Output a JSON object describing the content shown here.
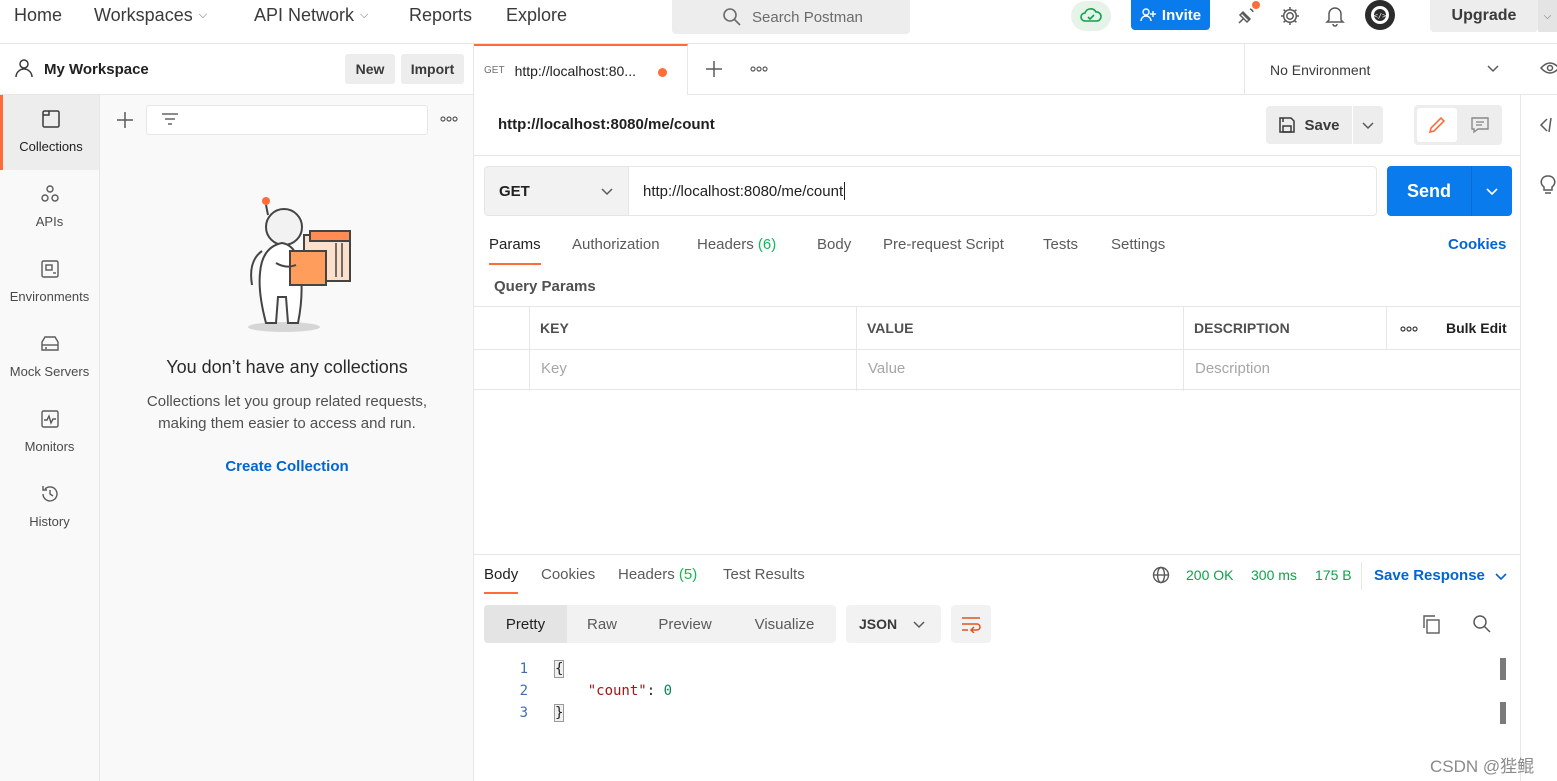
{
  "topnav": {
    "items": [
      {
        "label": "Home",
        "has_chevron": false
      },
      {
        "label": "Workspaces",
        "has_chevron": true
      },
      {
        "label": "API Network",
        "has_chevron": true
      },
      {
        "label": "Reports",
        "has_chevron": false
      },
      {
        "label": "Explore",
        "has_chevron": false
      }
    ],
    "search_placeholder": "Search Postman",
    "invite_label": "Invite",
    "upgrade_label": "Upgrade"
  },
  "workspace": {
    "title": "My Workspace",
    "new_label": "New",
    "import_label": "Import"
  },
  "rail": {
    "items": [
      {
        "label": "Collections",
        "icon": "collections-icon",
        "active": true
      },
      {
        "label": "APIs",
        "icon": "apis-icon",
        "active": false
      },
      {
        "label": "Environments",
        "icon": "environments-icon",
        "active": false
      },
      {
        "label": "Mock Servers",
        "icon": "mock-servers-icon",
        "active": false
      },
      {
        "label": "Monitors",
        "icon": "monitors-icon",
        "active": false
      },
      {
        "label": "History",
        "icon": "history-icon",
        "active": false
      }
    ]
  },
  "collections": {
    "empty_title": "You don’t have any collections",
    "empty_line1": "Collections let you group related requests,",
    "empty_line2": "making them easier to access and run.",
    "create_label": "Create Collection"
  },
  "tab": {
    "method": "GET",
    "title": "http://localhost:80..."
  },
  "environment": {
    "selected": "No Environment"
  },
  "request": {
    "name": "http://localhost:8080/me/count",
    "save_label": "Save",
    "method": "GET",
    "url": "http://localhost:8080/me/count",
    "send_label": "Send",
    "tabs": [
      {
        "label": "Params",
        "count": "",
        "active": true
      },
      {
        "label": "Authorization",
        "count": "",
        "active": false
      },
      {
        "label": "Headers",
        "count": "(6)",
        "active": false
      },
      {
        "label": "Body",
        "count": "",
        "active": false
      },
      {
        "label": "Pre-request Script",
        "count": "",
        "active": false
      },
      {
        "label": "Tests",
        "count": "",
        "active": false
      },
      {
        "label": "Settings",
        "count": "",
        "active": false
      }
    ],
    "cookies_label": "Cookies",
    "query_params_label": "Query Params",
    "table": {
      "headers": [
        "KEY",
        "VALUE",
        "DESCRIPTION"
      ],
      "bulk_edit_label": "Bulk Edit",
      "placeholders": [
        "Key",
        "Value",
        "Description"
      ]
    }
  },
  "response": {
    "tabs": [
      {
        "label": "Body",
        "count": "",
        "active": true
      },
      {
        "label": "Cookies",
        "count": "",
        "active": false
      },
      {
        "label": "Headers",
        "count": "(5)",
        "active": false
      },
      {
        "label": "Test Results",
        "count": "",
        "active": false
      }
    ],
    "status": "200 OK",
    "time": "300 ms",
    "size": "175 B",
    "save_label": "Save Response",
    "views": [
      "Pretty",
      "Raw",
      "Preview",
      "Visualize"
    ],
    "active_view": "Pretty",
    "format": "JSON",
    "lines": [
      {
        "n": "1",
        "text": "{"
      },
      {
        "n": "2",
        "key": "\"count\"",
        "sep": ": ",
        "value": "0"
      },
      {
        "n": "3",
        "text": "}"
      }
    ]
  },
  "watermark": "CSDN @狴鲲",
  "colors": {
    "accent": "#ff6c37",
    "primary": "#097bed",
    "link": "#0265d2",
    "success": "#0ca34a"
  }
}
